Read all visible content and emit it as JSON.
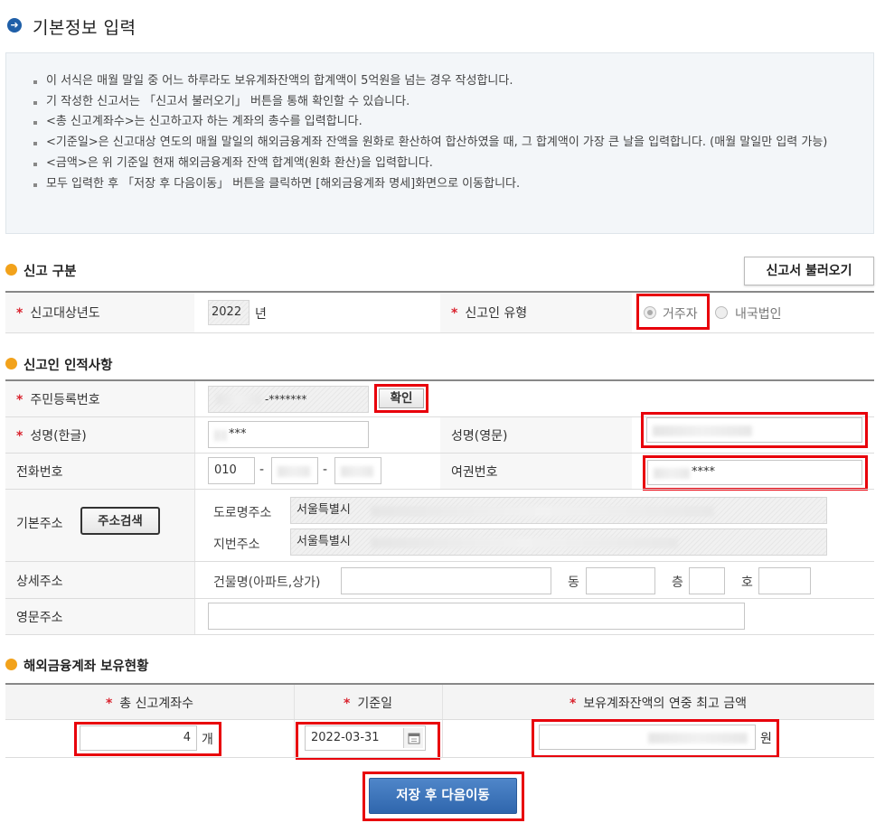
{
  "page": {
    "title": "기본정보 입력"
  },
  "notice": [
    "이 서식은 매월 말일 중 어느 하루라도 보유계좌잔액의 합계액이 5억원을 넘는 경우 작성합니다.",
    "기 작성한 신고서는 「신고서 불러오기」 버튼을 통해 확인할 수 있습니다.",
    "<총 신고계좌수>는 신고하고자 하는 계좌의 총수를 입력합니다.",
    "<기준일>은 신고대상 연도의 매월 말일의 해외금융계좌 잔액을 원화로 환산하여 합산하였을 때, 그 합계액이 가장 큰 날을 입력합니다. (매월 말일만 입력 가능)",
    "<금액>은 위 기준일 현재 해외금융계좌 잔액 합계액(원화 환산)을 입력합니다.",
    "모두 입력한 후 「저장 후 다음이동」 버튼을 클릭하면 [해외금융계좌 명세]화면으로 이동합니다."
  ],
  "report_type": {
    "title": "신고 구분",
    "load_button": "신고서 불러오기",
    "year_label": "신고대상년도",
    "year_value": "2022",
    "year_unit": "년",
    "reporter_type_label": "신고인 유형",
    "reporter_options": [
      "거주자",
      "내국법인"
    ],
    "star": "*"
  },
  "personal": {
    "title": "신고인 인적사항",
    "rrn_label": "주민등록번호",
    "rrn_value": "-*******",
    "confirm_button": "확인",
    "name_kr_label": "성명(한글)",
    "name_kr_value": "***",
    "name_en_label": "성명(영문)",
    "phone_label": "전화번호",
    "phone_prefix": "010",
    "phone_sep": "-",
    "passport_label": "여권번호",
    "passport_value": "****",
    "addr_label": "기본주소",
    "addr_search_button": "주소검색",
    "road_label": "도로명주소",
    "road_value": "서울특별시",
    "jibun_label": "지번주소",
    "jibun_value": "서울특별시",
    "detail_label": "상세주소",
    "building_label": "건물명(아파트,상가)",
    "dong_label": "동",
    "floor_label": "층",
    "ho_label": "호",
    "en_addr_label": "영문주소"
  },
  "holdings": {
    "title": "해외금융계좌 보유현황",
    "col_count": "총 신고계좌수",
    "col_date": "기준일",
    "col_amount": "보유계좌잔액의 연중 최고 금액",
    "count_value": "4",
    "count_unit": "개",
    "date_value": "2022-03-31",
    "amount_unit": "원"
  },
  "save_button": "저장 후 다음이동",
  "colors": {
    "accent": "#2f66ad",
    "highlight": "#e8000b",
    "section_icon": "#f2a21b"
  }
}
